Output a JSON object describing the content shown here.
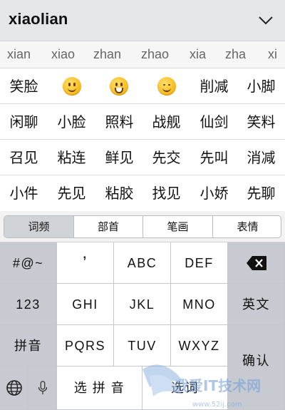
{
  "header": {
    "input_text": "xiaolian"
  },
  "pinyin": [
    "xian",
    "xiao",
    "zhan",
    "zhao",
    "xia",
    "zha",
    "xi"
  ],
  "candidates": [
    [
      "笑脸",
      "",
      "",
      "",
      "削减",
      "小脚"
    ],
    [
      "闲聊",
      "小脸",
      "照料",
      "战舰",
      "仙剑",
      "笑料"
    ],
    [
      "召见",
      "粘连",
      "鲜见",
      "先交",
      "先叫",
      "消减"
    ],
    [
      "小件",
      "先见",
      "粘胶",
      "找见",
      "小娇",
      "先聊"
    ]
  ],
  "emoji_icons": [
    "smile-emoji-icon",
    "grin-emoji-icon",
    "blush-emoji-icon"
  ],
  "segments": {
    "items": [
      "词频",
      "部首",
      "笔画",
      "表情"
    ],
    "active": 0
  },
  "keyboard": {
    "symbols": "#@~",
    "numbers": "123",
    "pinyin_mode": "拼音",
    "key_punct": "’",
    "key_abc": "ABC",
    "key_def": "DEF",
    "key_ghi": "GHI",
    "key_jkl": "JKL",
    "key_mno": "MNO",
    "key_pqrs": "PQRS",
    "key_tuv": "TUV",
    "key_wxyz": "WXYZ",
    "english": "英文",
    "confirm": "确认",
    "select_pinyin": "选 拼 音",
    "select_word": "选词"
  },
  "watermark": {
    "text": "我爱IT技术网",
    "url": "www.52ij.com"
  },
  "colors": {
    "keyboard_bg": "#d5d8dc",
    "key_light": "#ffffff",
    "key_dark": "#c7cbd1"
  }
}
